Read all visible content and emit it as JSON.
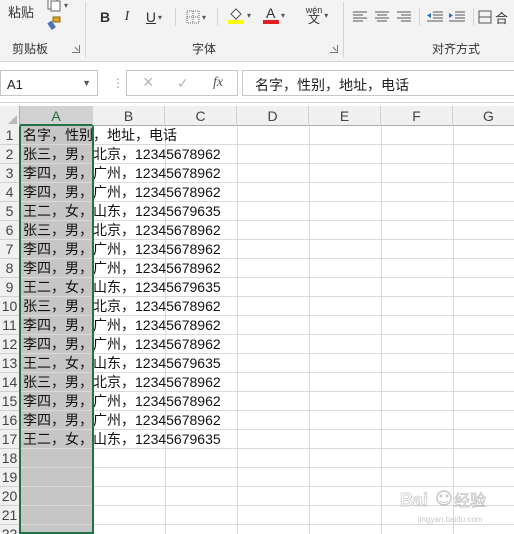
{
  "ribbon": {
    "clipboard": {
      "paste_label": "粘贴",
      "group_label": "剪贴板"
    },
    "font": {
      "group_label": "字体",
      "bold": "B",
      "italic": "I",
      "underline": "U",
      "font_color_letter": "A",
      "wen_label": "wén\n文"
    },
    "alignment": {
      "group_label": "对齐方式",
      "merge_label": "合"
    }
  },
  "formula_bar": {
    "name_box": "A1",
    "cancel_icon": "×",
    "enter_icon": "✓",
    "fx_label": "fx",
    "formula": "名字，性别，地址，电话"
  },
  "columns": [
    "A",
    "B",
    "C",
    "D",
    "E",
    "F",
    "G"
  ],
  "selected_column": "A",
  "rows": [
    {
      "n": "1",
      "text": "名字，性别，地址，电话"
    },
    {
      "n": "2",
      "text": "张三，男，北京，12345678962"
    },
    {
      "n": "3",
      "text": "李四，男，广州，12345678962"
    },
    {
      "n": "4",
      "text": "李四，男，广州，12345678962"
    },
    {
      "n": "5",
      "text": "王二，女，山东，12345679635"
    },
    {
      "n": "6",
      "text": "张三，男，北京，12345678962"
    },
    {
      "n": "7",
      "text": "李四，男，广州，12345678962"
    },
    {
      "n": "8",
      "text": "李四，男，广州，12345678962"
    },
    {
      "n": "9",
      "text": "王二，女，山东，12345679635"
    },
    {
      "n": "10",
      "text": "张三，男，北京，12345678962"
    },
    {
      "n": "11",
      "text": "李四，男，广州，12345678962"
    },
    {
      "n": "12",
      "text": "李四，男，广州，12345678962"
    },
    {
      "n": "13",
      "text": "王二，女，山东，12345679635"
    },
    {
      "n": "14",
      "text": "张三，男，北京，12345678962"
    },
    {
      "n": "15",
      "text": "李四，男，广州，12345678962"
    },
    {
      "n": "16",
      "text": "李四，男，广州，12345678962"
    },
    {
      "n": "17",
      "text": "王二，女，山东，12345679635"
    },
    {
      "n": "18",
      "text": ""
    },
    {
      "n": "19",
      "text": ""
    },
    {
      "n": "20",
      "text": ""
    },
    {
      "n": "21",
      "text": ""
    },
    {
      "n": "22",
      "text": ""
    }
  ],
  "colors": {
    "accent": "#217346",
    "selection": "#c6c6c6",
    "font_color_bar": "#e02020",
    "highlight_bar": "#ffff00"
  },
  "watermark": "Baidu 经验"
}
